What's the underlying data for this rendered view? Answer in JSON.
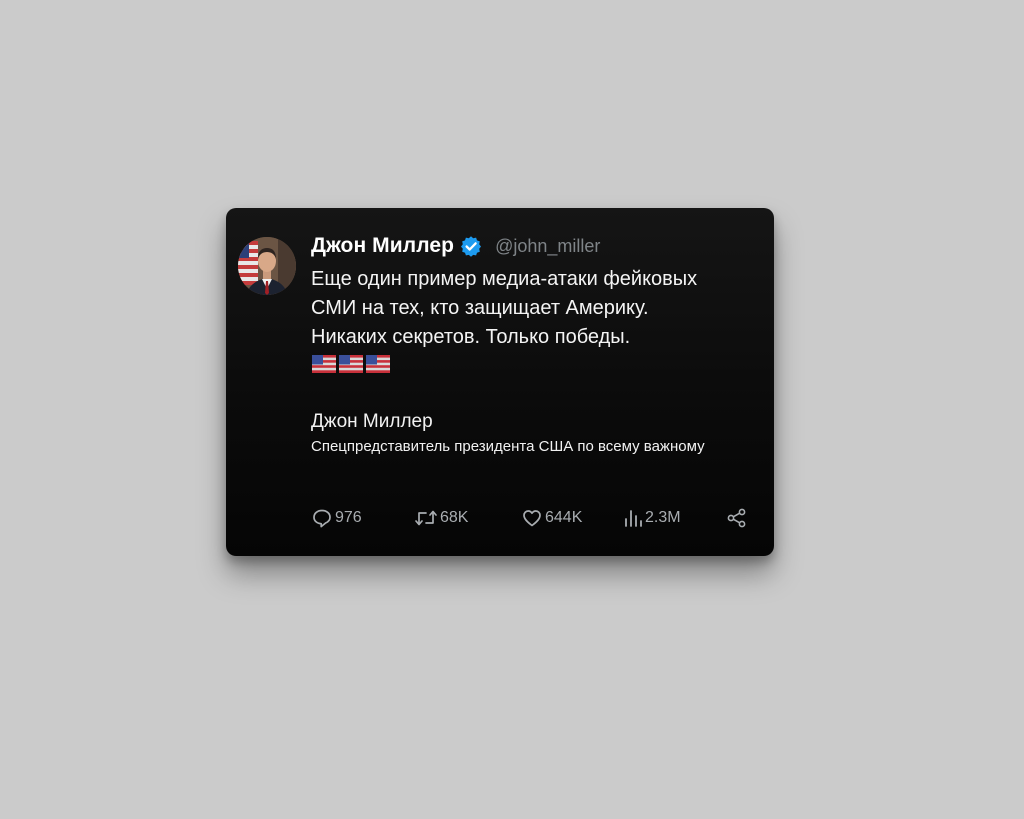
{
  "tweet": {
    "author": {
      "display_name": "Джон Миллер",
      "handle": "@john_miller",
      "verified": true,
      "avatar_icon": "avatar-portrait-with-us-flag"
    },
    "text_lines": [
      "Еще один пример медиа-атаки фейковых",
      "СМИ на тех, кто защищает Америку.",
      "Никаких секретов. Только победы."
    ],
    "emoji_flags": [
      "us-flag-icon",
      "us-flag-icon",
      "us-flag-icon"
    ],
    "signature": {
      "name": "Джон Миллер",
      "title": "Спецпредставитель президента США по всему важному"
    },
    "actions": {
      "replies": "976",
      "retweets": "68K",
      "likes": "644K",
      "views": "2.3M"
    }
  },
  "colors": {
    "background": "#cbcbcb",
    "card": "#0d0d0d",
    "verified_badge": "#1d9bf0",
    "handle": "#7f8488",
    "action_text": "#a9adb1"
  }
}
